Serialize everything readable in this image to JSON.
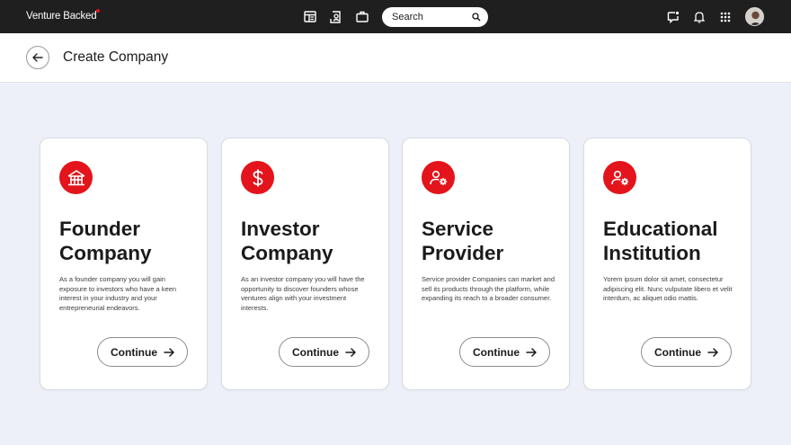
{
  "topbar": {
    "brand": "Venture Backed",
    "search_placeholder": "Search",
    "nav_icons": [
      "dashboard-icon",
      "contacts-icon",
      "briefcase-icon"
    ],
    "right_icons": [
      "message-icon",
      "bell-icon",
      "apps-grid-icon"
    ]
  },
  "header": {
    "title": "Create Company"
  },
  "colors": {
    "accent": "#e3141b",
    "topbar": "#1f1f20",
    "background": "#eef0f9"
  },
  "cards": [
    {
      "icon": "building-icon",
      "title_line1": "Founder",
      "title_line2": "Company",
      "description": "As a founder company you will gain exposure to investors who have a keen interest in your industry and your entrepreneurial endeavors.",
      "button": "Continue"
    },
    {
      "icon": "dollar-icon",
      "title_line1": "Investor",
      "title_line2": "Company",
      "description": "As an investor company you will have the opportunity to discover founders whose ventures align with your investment interests.",
      "button": "Continue"
    },
    {
      "icon": "user-gear-icon",
      "title_line1": "Service",
      "title_line2": "Provider",
      "description": "Service provider Companies can market and sell its products through the platform, while expanding its reach to a broader consumer.",
      "button": "Continue"
    },
    {
      "icon": "user-gear-icon",
      "title_line1": "Educational",
      "title_line2": "Institution",
      "description": "Yorem ipsum dolor sit amet, consectetur adipiscing elit. Nunc vulputate libero et velit interdum, ac aliquet odio mattis.",
      "button": "Continue"
    }
  ]
}
